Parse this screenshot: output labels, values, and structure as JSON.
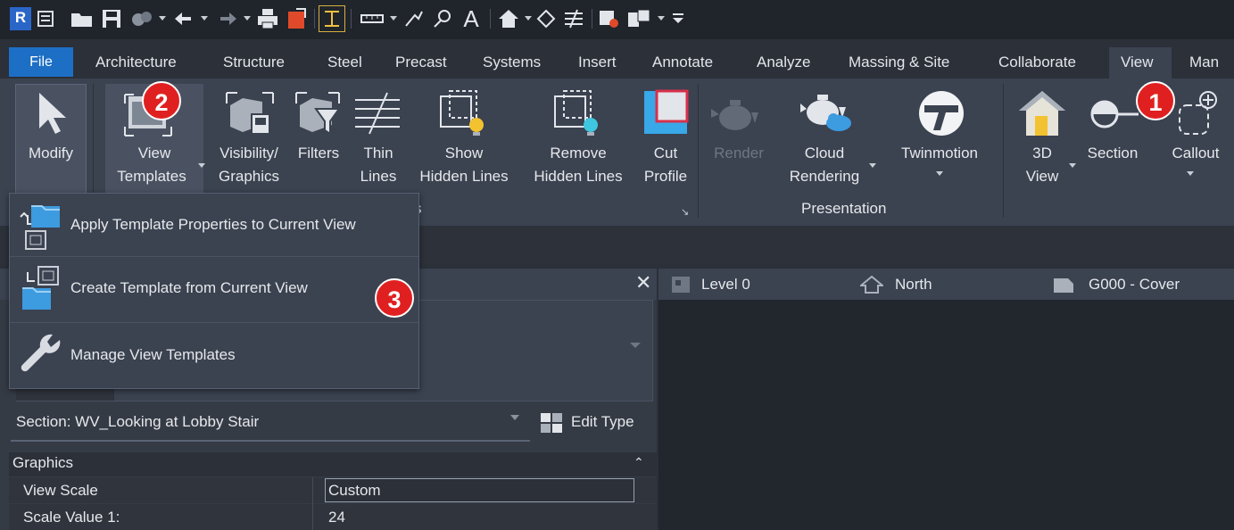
{
  "app": {
    "logo_letter": "R"
  },
  "tabs": [
    "File",
    "Architecture",
    "Structure",
    "Steel",
    "Precast",
    "Systems",
    "Insert",
    "Annotate",
    "Analyze",
    "Massing & Site",
    "Collaborate",
    "View",
    "Man"
  ],
  "ribbon": {
    "modify": "Modify",
    "view_templates": [
      "View",
      "Templates"
    ],
    "visibility_graphics": [
      "Visibility/",
      "Graphics"
    ],
    "filters": "Filters",
    "thin_lines": [
      "Thin",
      "Lines"
    ],
    "show_hidden_lines": [
      "Show",
      "Hidden Lines"
    ],
    "remove_hidden_lines": [
      "Remove",
      "Hidden Lines"
    ],
    "cut_profile": [
      "Cut",
      "Profile"
    ],
    "render": "Render",
    "cloud_rendering": [
      "Cloud",
      "Rendering"
    ],
    "twinmotion": "Twinmotion",
    "view_3d": [
      "3D",
      "View"
    ],
    "section": "Section",
    "callout": "Callout",
    "panel_presentation": "Presentation",
    "panel_graphics_partial": "s"
  },
  "menu": {
    "items": [
      {
        "label": "Apply Template Properties to Current View"
      },
      {
        "label": "Create Template from Current View"
      },
      {
        "label": "Manage View Templates"
      }
    ]
  },
  "badges": [
    "1",
    "2",
    "3"
  ],
  "properties": {
    "instance_selector": "Section: WV_Looking at Lobby Stair",
    "edit_type": "Edit Type",
    "group": "Graphics",
    "rows": [
      {
        "name": "View Scale",
        "value": "Custom"
      },
      {
        "name": "Scale Value    1:",
        "value": "24"
      }
    ]
  },
  "view_tabs": [
    {
      "label": "Level 0"
    },
    {
      "label": "North"
    },
    {
      "label": "G000 - Cover"
    }
  ],
  "colors": {
    "accent": "#1d6fc5",
    "badge": "#e02020",
    "ribbon": "#3b4250"
  }
}
